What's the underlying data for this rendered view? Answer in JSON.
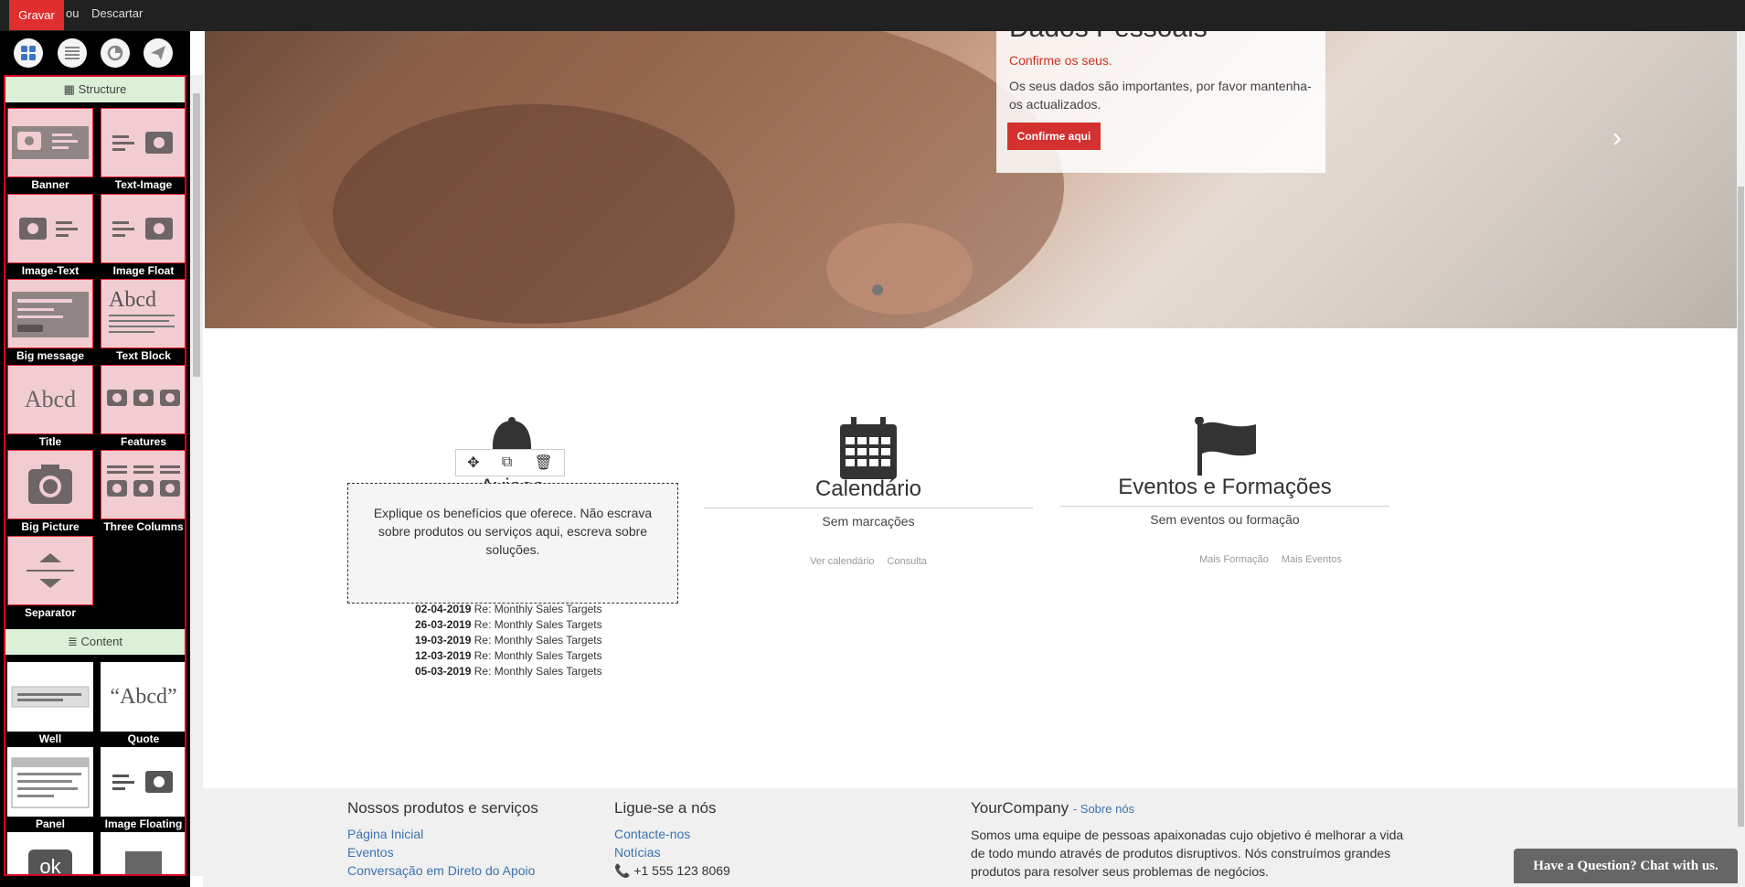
{
  "topbar": {
    "save_label": "Gravar",
    "or_label": "ou",
    "discard_label": "Descartar"
  },
  "panel": {
    "categories": [
      {
        "label": "Structure",
        "snippets": [
          "Banner",
          "Text-Image",
          "Image-Text",
          "Image Float",
          "Big message",
          "Text Block",
          "Title",
          "Features",
          "Big Picture",
          "Three Columns",
          "Separator"
        ]
      },
      {
        "label": "Content",
        "snippets": [
          "Well",
          "Quote",
          "Panel",
          "Image Floating"
        ]
      }
    ],
    "thumb_texts": {
      "text_block": "Abcd",
      "title": "Abcd",
      "quote": "Abcd",
      "ok": "ok"
    }
  },
  "hero": {
    "title": "Dados Pessoais",
    "subtitle": "Confirme os seus.",
    "text": "Os seus dados são importantes, por favor mantenha-os actualizados.",
    "button": "Confirme aqui"
  },
  "columns": [
    {
      "icon": "bell-icon",
      "title": "Avisos",
      "editable_text": "Explique os benefícios que oferece. Não escrava sobre produtos ou serviços aqui, escreva sobre soluções."
    },
    {
      "icon": "calendar-icon",
      "title": "Calendário",
      "subtitle": "Sem marcações",
      "links": [
        "Ver calendário",
        "Consulta"
      ]
    },
    {
      "icon": "flag-icon",
      "title": "Eventos e Formações",
      "subtitle": "Sem eventos ou formação",
      "links": [
        "Mais Formação",
        "Mais Eventos"
      ]
    }
  ],
  "news": [
    {
      "date": "02-04-2019",
      "subject": "Re: Monthly Sales Targets"
    },
    {
      "date": "26-03-2019",
      "subject": "Re: Monthly Sales Targets"
    },
    {
      "date": "19-03-2019",
      "subject": "Re: Monthly Sales Targets"
    },
    {
      "date": "12-03-2019",
      "subject": "Re: Monthly Sales Targets"
    },
    {
      "date": "05-03-2019",
      "subject": "Re: Monthly Sales Targets"
    }
  ],
  "footer": {
    "products": {
      "title": "Nossos produtos e serviços",
      "links": [
        "Página Inicial",
        "Eventos",
        "Conversação em Direto do Apoio"
      ]
    },
    "contact": {
      "title": "Ligue-se a nós",
      "links": [
        "Contacte-nos",
        "Notícias"
      ],
      "phone": "+1 555 123 8069"
    },
    "company": {
      "title": "YourCompany",
      "about": "- Sobre nós",
      "text": "Somos uma equipe de pessoas apaixonadas cujo objetivo é melhorar a vida de todo mundo através de produtos disruptivos. Nós construímos grandes produtos para resolver seus problemas de negócios."
    }
  },
  "chat": {
    "label": "Have a Question? Chat with us."
  }
}
